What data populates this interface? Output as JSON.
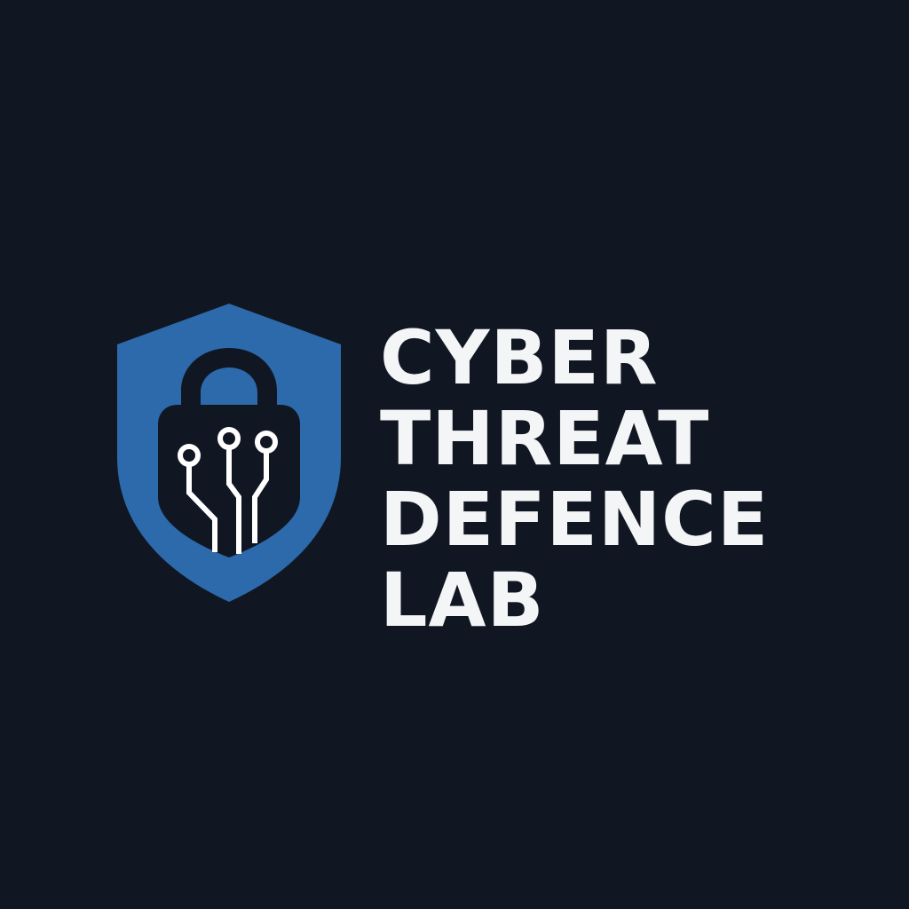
{
  "logo": {
    "lines": [
      "CYBER",
      "THREAT",
      "DEFENCE",
      "LAB"
    ],
    "emblem_icon": "shield-padlock-circuit-icon"
  },
  "colors": {
    "background": "#111722",
    "shield": "#2c6aac",
    "lock": "#111722",
    "circuit": "#ffffff",
    "text": "#f4f5f7"
  }
}
